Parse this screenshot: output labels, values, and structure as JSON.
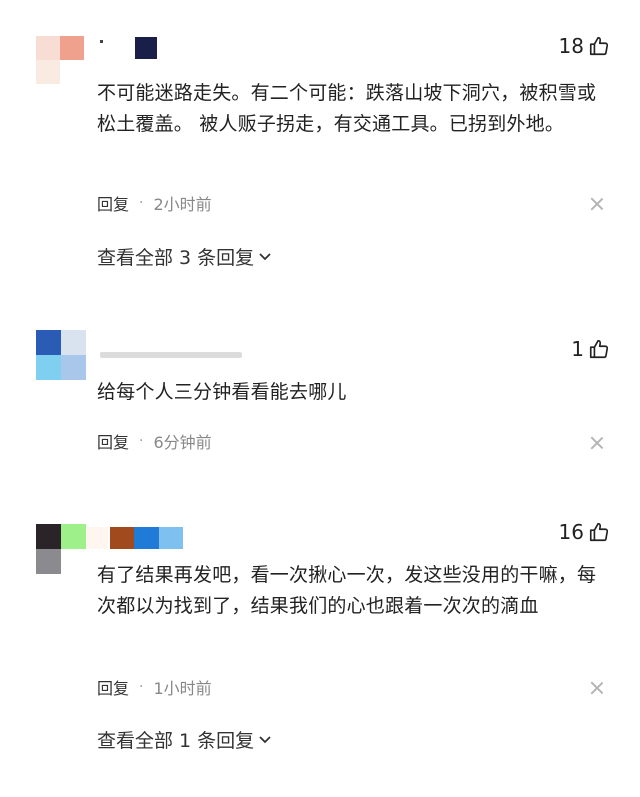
{
  "comments": [
    {
      "likes": "18",
      "text": "不可能迷路走失。有二个可能：跌落山坡下洞穴，被积雪或松土覆盖。 被人贩子拐走，有交通工具。已拐到外地。",
      "reply_label": "回复",
      "time": "2小时前",
      "view_replies": "查看全部 3 条回复"
    },
    {
      "likes": "1",
      "text": "给每个人三分钟看看能去哪儿",
      "reply_label": "回复",
      "time": "6分钟前"
    },
    {
      "likes": "16",
      "text": "有了结果再发吧，看一次揪心一次，发这些没用的干嘛，每次都以为找到了，结果我们的心也跟着一次次的滴血",
      "reply_label": "回复",
      "time": "1小时前",
      "view_replies": "查看全部 1 条回复"
    }
  ],
  "icons": {
    "like": "thumbs-up-icon",
    "dismiss": "close-icon",
    "expand": "chevron-down-icon"
  },
  "colors": {
    "text": "#222222",
    "meta": "#888888",
    "icon_gray": "#b5b5b5"
  }
}
